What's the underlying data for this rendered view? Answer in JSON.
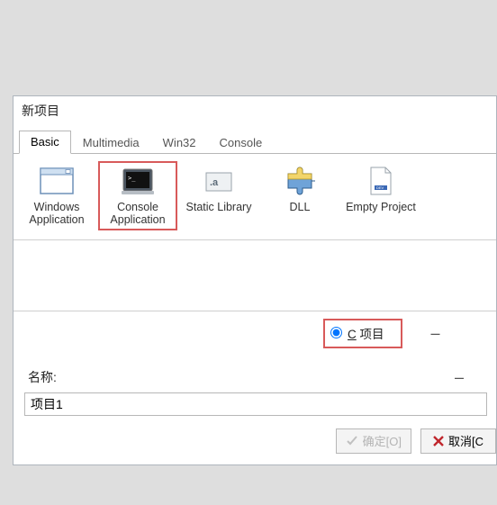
{
  "dialog": {
    "title": "新项目",
    "tabs": [
      {
        "label": "Basic",
        "active": true
      },
      {
        "label": "Multimedia",
        "active": false
      },
      {
        "label": "Win32",
        "active": false
      },
      {
        "label": "Console",
        "active": false
      }
    ],
    "templates": [
      {
        "name": "windows-application",
        "label": "Windows Application",
        "icon": "window-icon",
        "highlighted": false
      },
      {
        "name": "console-application",
        "label": "Console Application",
        "icon": "terminal-icon",
        "highlighted": true
      },
      {
        "name": "static-library",
        "label": "Static Library",
        "icon": "library-icon",
        "highlighted": false
      },
      {
        "name": "dll",
        "label": "DLL",
        "icon": "puzzle-icon",
        "highlighted": false
      },
      {
        "name": "empty-project",
        "label": "Empty Project",
        "icon": "document-icon",
        "highlighted": false
      }
    ],
    "lang_radio": {
      "c_label_u": "C",
      "c_label_rest": " 项目",
      "selected": "c"
    },
    "name_label": "名称:",
    "name_value": "项目1",
    "buttons": {
      "ok_label": "确定[O]",
      "cancel_label": "取消[C",
      "ok_enabled": false
    }
  }
}
